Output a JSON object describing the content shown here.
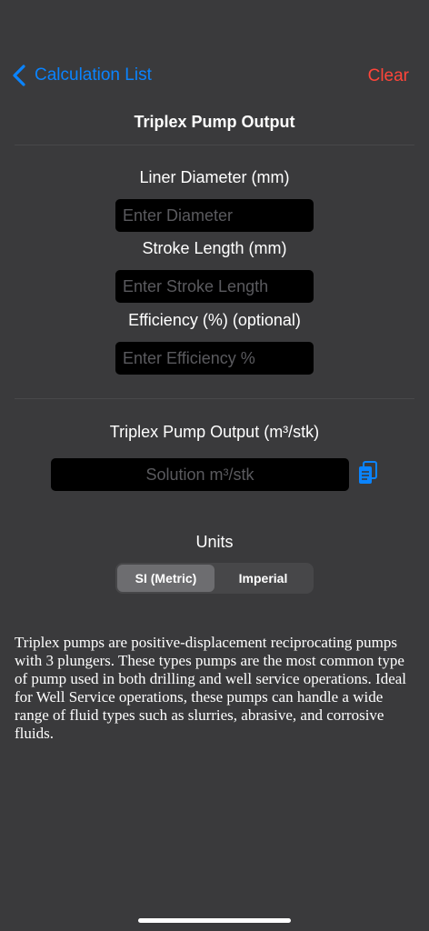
{
  "nav": {
    "back_label": "Calculation List",
    "clear_label": "Clear"
  },
  "page": {
    "title": "Triplex Pump Output"
  },
  "inputs": [
    {
      "label": "Liner Diameter (mm)",
      "value": "",
      "placeholder": "Enter Diameter"
    },
    {
      "label": "Stroke Length (mm)",
      "value": "",
      "placeholder": "Enter Stroke Length"
    },
    {
      "label": "Efficiency (%) (optional)",
      "value": "",
      "placeholder": "Enter Efficiency %"
    }
  ],
  "result": {
    "label": "Triplex Pump Output (m³/stk)",
    "value": "",
    "placeholder": "Solution m³/stk",
    "copy_icon": "copy-icon"
  },
  "units": {
    "label": "Units",
    "options": [
      "SI (Metric)",
      "Imperial"
    ],
    "selected": "SI (Metric)"
  },
  "description": "Triplex pumps are positive-displacement reciprocating pumps with 3 plungers. These types pumps are the most common type of pump used in both drilling and well service operations. Ideal for Well Service operations, these pumps can handle a wide range of fluid types such as slurries, abrasive, and corrosive fluids.",
  "colors": {
    "background": "#3a3a3c",
    "accent": "#0a84ff",
    "destructive": "#ff453a",
    "field": "#000000"
  }
}
